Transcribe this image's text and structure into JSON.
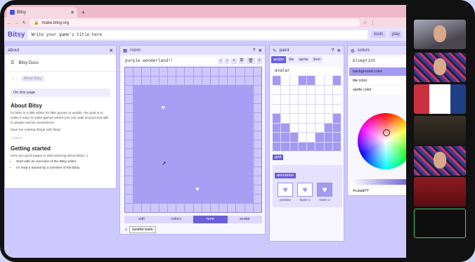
{
  "browser": {
    "tab_title": "Bitsy",
    "new_tab": "+",
    "url": "make.bitsy.org"
  },
  "app": {
    "logo": "Bitsy",
    "title_placeholder": "Write your game's title here",
    "tools": "tools",
    "play": "play"
  },
  "about": {
    "header": "about",
    "docs": "Bitsy Docs",
    "breadcrumb": "About Bitsy",
    "on_this_page": "On this page",
    "heading": "About Bitsy",
    "p1": "hi! bitsy is a little editor for little games or worlds. the goal is to make it easy to make games where you can walk around and talk to people and be somewhere.",
    "p2": "have fun making things with bitsy!",
    "edit": "+ admin",
    "heading2": "Getting started",
    "p3": "Here are good pages to start learning about Bitsy! :)",
    "li1": "Start with an overview of the Bitsy editor",
    "li2": "Or read a tutorial by a member of the Bitsy"
  },
  "room": {
    "header": "room",
    "name": "purple wonderland!!",
    "tabs": [
      "edit",
      "colors",
      "tune",
      "avatar"
    ],
    "tune_label": "tuneful town"
  },
  "paint": {
    "header": "paint",
    "tabs": [
      "avatar",
      "tile",
      "sprite",
      "item"
    ],
    "name": "avatar",
    "grid": "grid",
    "animation": "animation",
    "frames": [
      "preview",
      "frame 1",
      "frame 2"
    ]
  },
  "colors": {
    "header": "colors",
    "palette": "blueprint",
    "items": [
      "background color",
      "tile color",
      "sprite color"
    ],
    "hex": "#cea8ff"
  },
  "colors_hex": {
    "accent": "#6a5fd8",
    "room_bg": "#a89ef4",
    "wall": "#cfc8ff"
  }
}
